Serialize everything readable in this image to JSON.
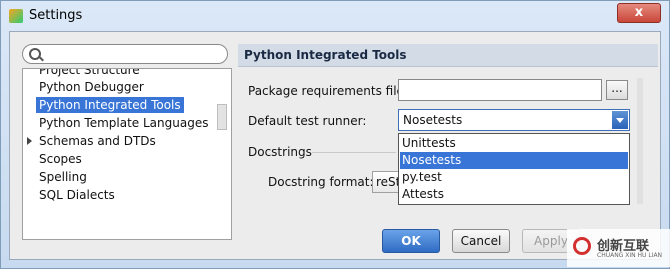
{
  "window": {
    "title": "Settings",
    "close_glyph": "x"
  },
  "sidebar": {
    "search_placeholder": "",
    "items": [
      {
        "label": "Project Structure"
      },
      {
        "label": "Python Debugger"
      },
      {
        "label": "Python Integrated Tools",
        "selected": true
      },
      {
        "label": "Python Template Languages"
      },
      {
        "label": "Schemas and DTDs",
        "expandable": true
      },
      {
        "label": "Scopes"
      },
      {
        "label": "Spelling"
      },
      {
        "label": "SQL Dialects"
      }
    ]
  },
  "panel": {
    "title": "Python Integrated Tools",
    "package_requirements_label": "Package requirements file:",
    "package_requirements_value": "",
    "browse_label": "...",
    "test_runner_label": "Default test runner:",
    "test_runner_value": "Nosetests",
    "test_runner_options": [
      "Unittests",
      "Nosetests",
      "py.test",
      "Attests"
    ],
    "test_runner_highlighted": "Nosetests",
    "docstrings_section": "Docstrings",
    "docstring_format_label": "Docstring format:",
    "docstring_format_value": "reSt"
  },
  "buttons": {
    "ok": "OK",
    "cancel": "Cancel",
    "apply": "Apply"
  },
  "watermark": {
    "text": "创新互联",
    "subtext": "CHUANG XIN HU LIAN"
  },
  "colors": {
    "selection": "#3875d7",
    "ok_button": "#2f6bc4"
  }
}
